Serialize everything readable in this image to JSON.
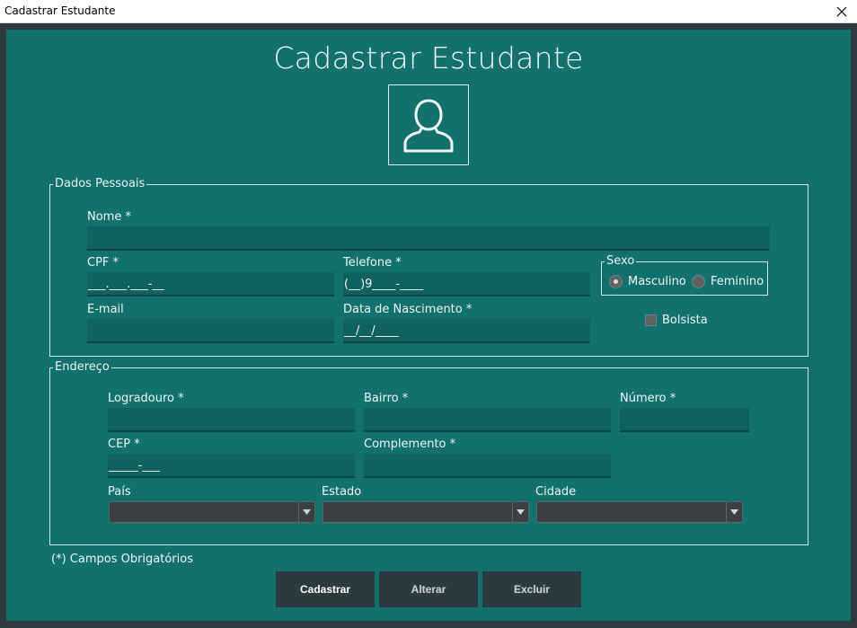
{
  "window": {
    "title": "Cadastrar Estudante"
  },
  "page": {
    "heading": "Cadastrar Estudante"
  },
  "personal": {
    "legend": "Dados Pessoais",
    "name_label": "Nome *",
    "name_value": "",
    "cpf_label": "CPF *",
    "cpf_value": "___.___.___-__",
    "phone_label": "Telefone *",
    "phone_value": "(__)9____-____",
    "email_label": "E-mail",
    "email_value": "",
    "birth_label": "Data de Nascimento *",
    "birth_value": "__/__/____",
    "sex_legend": "Sexo",
    "sex_male": "Masculino",
    "sex_female": "Feminino",
    "sex_selected": "Masculino",
    "scholarship_label": "Bolsista",
    "scholarship_checked": false
  },
  "address": {
    "legend": "Endereço",
    "street_label": "Logradouro *",
    "street_value": "",
    "district_label": "Bairro *",
    "district_value": "",
    "number_label": "Número *",
    "number_value": "",
    "zip_label": "CEP *",
    "zip_value": "_____-___",
    "complement_label": "Complemento *",
    "complement_value": "",
    "country_label": "País",
    "country_value": "",
    "state_label": "Estado",
    "state_value": "",
    "city_label": "Cidade",
    "city_value": ""
  },
  "note": "(*) Campos Obrigatórios",
  "buttons": {
    "register": "Cadastrar",
    "update": "Alterar",
    "delete": "Excluir"
  },
  "icons": {
    "close": "close-icon",
    "avatar": "user-icon",
    "dropdown": "chevron-down-icon"
  },
  "colors": {
    "background": "#12716c",
    "field": "#0f625e",
    "button": "#2b3a3f",
    "frame": "#2d3b40"
  }
}
